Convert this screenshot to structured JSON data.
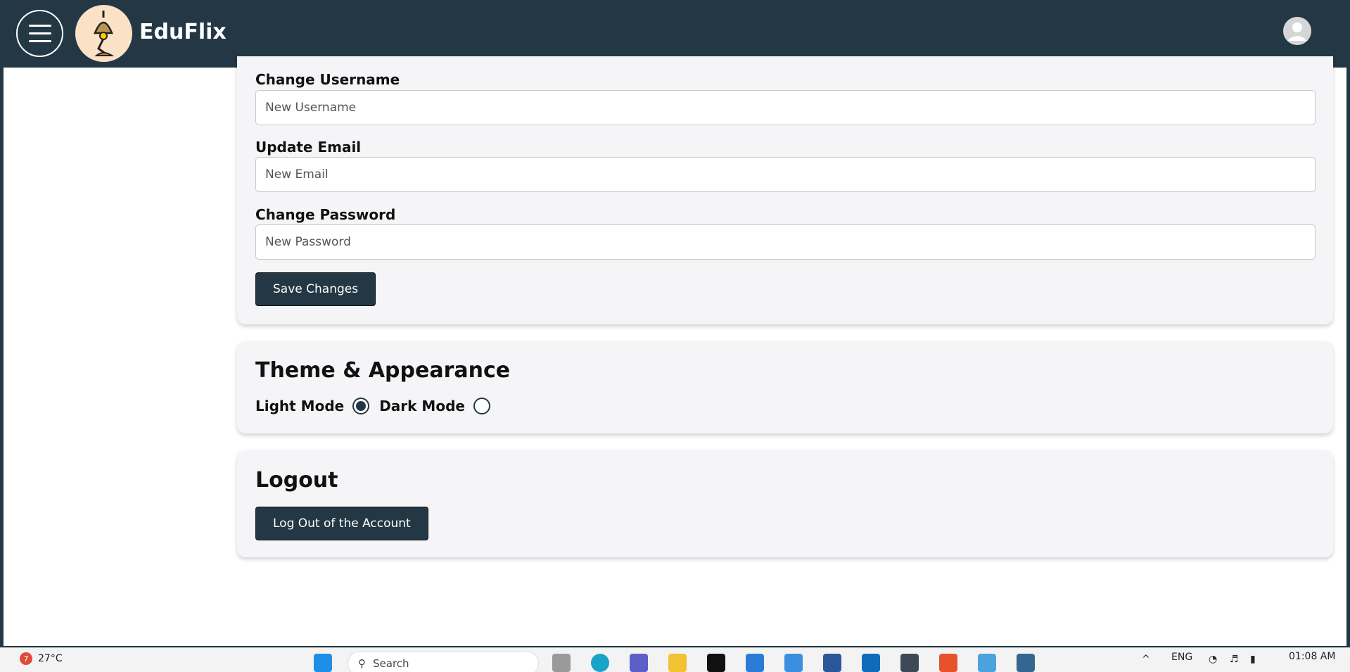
{
  "app": {
    "brand": "EduFlix"
  },
  "account": {
    "username_label": "Change Username",
    "username_placeholder": "New Username",
    "email_label": "Update Email",
    "email_placeholder": "New Email",
    "password_label": "Change Password",
    "password_placeholder": "New Password",
    "save_label": "Save Changes"
  },
  "theme": {
    "title": "Theme & Appearance",
    "light_label": "Light Mode",
    "dark_label": "Dark Mode",
    "selected": "light"
  },
  "logout": {
    "title": "Logout",
    "button_label": "Log Out of the Account"
  },
  "taskbar": {
    "weather_badge": "7",
    "temperature": "27°C",
    "search_placeholder": "Search",
    "language": "ENG",
    "time": "01:08 AM"
  },
  "icons": {
    "menu": "hamburger-icon",
    "logo": "desk-lamp-logo",
    "avatar": "user-avatar-icon"
  },
  "colors": {
    "navbar": "#233844",
    "button": "#233844",
    "card": "#f5f5f8"
  }
}
